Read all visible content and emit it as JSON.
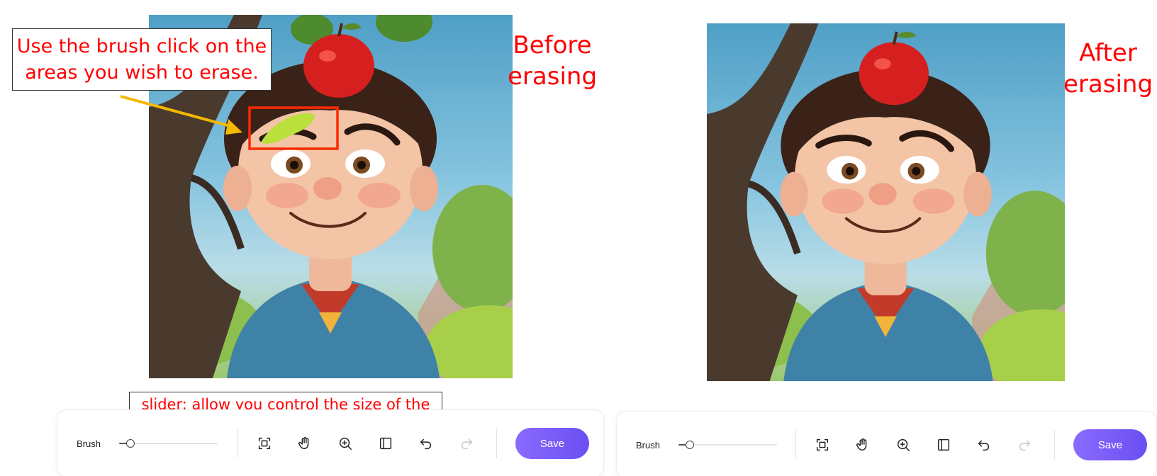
{
  "before": {
    "caption": "Before\nerasing",
    "callout": "Use the brush click on the areas you wish to erase.",
    "slider_callout": "slider: allow you control the size of the brush"
  },
  "after": {
    "caption": "After\nerasing"
  },
  "toolbar_left": {
    "brush_label": "Brush",
    "brush_size_percent": 8,
    "tools": [
      "fit-screen-icon",
      "hand-pan-icon",
      "zoom-in-icon",
      "compare-split-icon",
      "undo-icon",
      "redo-icon"
    ],
    "redo_enabled": false,
    "save_label": "Save"
  },
  "toolbar_right": {
    "brush_label": "Brush",
    "brush_size_percent": 8,
    "tools": [
      "fit-screen-icon",
      "hand-pan-icon",
      "zoom-in-icon",
      "compare-split-icon",
      "undo-icon",
      "redo-icon"
    ],
    "redo_enabled": false,
    "save_label": "Save"
  },
  "colors": {
    "annotation_red": "#ff0000",
    "arrow_yellow": "#f5b800",
    "brush_mark": "#b9e03c",
    "save_gradient_start": "#8a6bff",
    "save_gradient_end": "#6b4ef2"
  }
}
